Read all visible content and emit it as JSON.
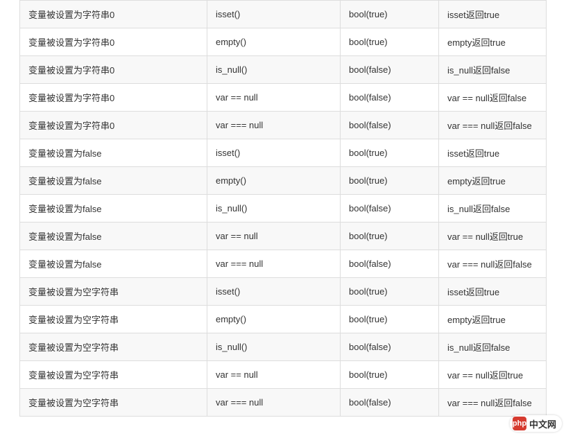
{
  "table": {
    "rows": [
      {
        "condition": "变量被设置为字符串0",
        "func": "isset()",
        "result": "bool(true)",
        "note": "isset返回true"
      },
      {
        "condition": "变量被设置为字符串0",
        "func": "empty()",
        "result": "bool(true)",
        "note": "empty返回true"
      },
      {
        "condition": "变量被设置为字符串0",
        "func": "is_null()",
        "result": "bool(false)",
        "note": "is_null返回false"
      },
      {
        "condition": "变量被设置为字符串0",
        "func": "var == null",
        "result": "bool(false)",
        "note": "var == null返回false"
      },
      {
        "condition": "变量被设置为字符串0",
        "func": "var === null",
        "result": "bool(false)",
        "note": "var === null返回false"
      },
      {
        "condition": "变量被设置为false",
        "func": "isset()",
        "result": "bool(true)",
        "note": "isset返回true"
      },
      {
        "condition": "变量被设置为false",
        "func": "empty()",
        "result": "bool(true)",
        "note": "empty返回true"
      },
      {
        "condition": "变量被设置为false",
        "func": "is_null()",
        "result": "bool(false)",
        "note": "is_null返回false"
      },
      {
        "condition": "变量被设置为false",
        "func": "var == null",
        "result": "bool(true)",
        "note": "var == null返回true"
      },
      {
        "condition": "变量被设置为false",
        "func": "var === null",
        "result": "bool(false)",
        "note": "var === null返回false"
      },
      {
        "condition": "变量被设置为空字符串",
        "func": "isset()",
        "result": "bool(true)",
        "note": "isset返回true"
      },
      {
        "condition": "变量被设置为空字符串",
        "func": "empty()",
        "result": "bool(true)",
        "note": "empty返回true"
      },
      {
        "condition": "变量被设置为空字符串",
        "func": "is_null()",
        "result": "bool(false)",
        "note": "is_null返回false"
      },
      {
        "condition": "变量被设置为空字符串",
        "func": "var == null",
        "result": "bool(true)",
        "note": "var == null返回true"
      },
      {
        "condition": "变量被设置为空字符串",
        "func": "var === null",
        "result": "bool(false)",
        "note": "var === null返回false"
      }
    ]
  },
  "watermark": {
    "logo_text": "php",
    "label": "中文网"
  }
}
